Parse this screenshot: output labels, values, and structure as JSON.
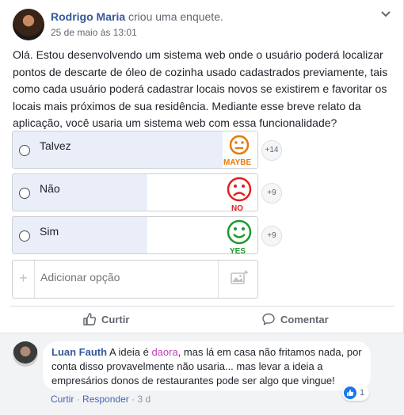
{
  "post": {
    "author": "Rodrigo Maria",
    "action": "criou uma enquete.",
    "timestamp": "25 de maio às 13:01",
    "text": "Olá. Estou desenvolvendo um sistema web onde o usuário poderá localizar pontos de descarte de óleo de cozinha usado cadastrados previamente, tais como cada usuário poderá cadastrar locais novos se existirem e favoritar os locais mais próximos de sua residência. Mediante esse breve relato da aplicação, você usaria um sistema web com essa funcionalidade?"
  },
  "poll": {
    "options": [
      {
        "label": "Talvez",
        "votes": "+14",
        "share": 1.0,
        "image_text": "MAYBE",
        "image_icon": "neutral-face-icon",
        "color": "#e8790c"
      },
      {
        "label": "Não",
        "votes": "+9",
        "share": 0.64,
        "image_text": "NO",
        "image_icon": "sad-face-icon",
        "color": "#e02020"
      },
      {
        "label": "Sim",
        "votes": "+9",
        "share": 0.64,
        "image_text": "YES",
        "image_icon": "happy-face-icon",
        "color": "#1c9a2c"
      }
    ],
    "add_option_placeholder": "Adicionar opção"
  },
  "actions": {
    "like": "Curtir",
    "comment": "Comentar"
  },
  "comment": {
    "author": "Luan Fauth",
    "text_before": " A ideia é ",
    "highlight": "daora",
    "text_after": ", mas lá em casa não fritamos nada, por conta disso provavelmente não usaria... mas levar a ideia a empresários donos de restaurantes pode ser algo que vingue!",
    "like_link": "Curtir",
    "separator": "·",
    "reply_link": "Responder",
    "age": "3 d",
    "reaction_count": "1"
  },
  "colors": {
    "link": "#365899",
    "poll_fill": "#e9eef8",
    "like_blue": "#1877f2"
  }
}
